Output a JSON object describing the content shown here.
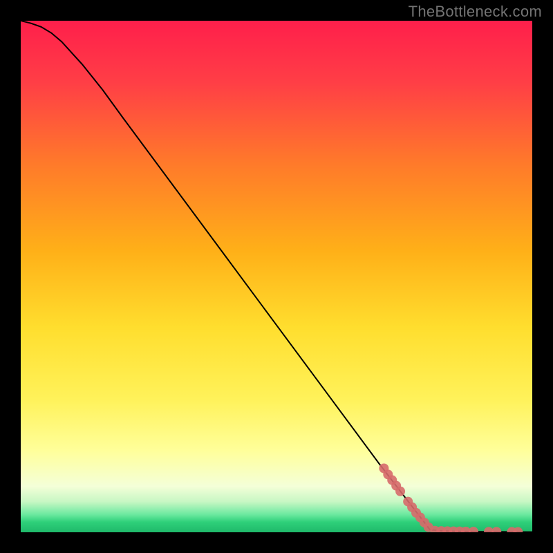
{
  "watermark": "TheBottleneck.com",
  "colors": {
    "background": "#000000",
    "curve": "#000000",
    "dot": "#d66a6a",
    "dot_stroke": "#d66a6a",
    "watermark": "#737373",
    "gradient_top": "#ff1f4b",
    "gradient_mid_upper": "#ff7a2a",
    "gradient_mid": "#ffde2e",
    "gradient_mid_lower": "#ffff7a",
    "gradient_lower": "#f2ffe0",
    "gradient_green": "#36e07f",
    "gradient_bottom": "#1fb96a"
  },
  "chart_data": {
    "type": "line",
    "title": "",
    "xlabel": "",
    "ylabel": "",
    "xlim": [
      0,
      100
    ],
    "ylim": [
      0,
      100
    ],
    "series": [
      {
        "name": "curve",
        "x": [
          0,
          2,
          4,
          6,
          8,
          12,
          16,
          20,
          30,
          40,
          50,
          60,
          70,
          80,
          82,
          84,
          86,
          90,
          94,
          100
        ],
        "y": [
          100,
          99.5,
          98.8,
          97.6,
          95.9,
          91.5,
          86.5,
          81.0,
          67.5,
          54.0,
          40.5,
          27.0,
          13.5,
          0.5,
          0.3,
          0.2,
          0.15,
          0.1,
          0.08,
          0.05
        ]
      }
    ],
    "scatter": {
      "name": "dots",
      "points": [
        {
          "x": 71.0,
          "y": 12.5
        },
        {
          "x": 71.8,
          "y": 11.3
        },
        {
          "x": 72.6,
          "y": 10.2
        },
        {
          "x": 73.4,
          "y": 9.1
        },
        {
          "x": 74.2,
          "y": 8.0
        },
        {
          "x": 75.7,
          "y": 6.0
        },
        {
          "x": 76.5,
          "y": 4.9
        },
        {
          "x": 77.3,
          "y": 3.8
        },
        {
          "x": 78.1,
          "y": 2.9
        },
        {
          "x": 78.9,
          "y": 1.9
        },
        {
          "x": 79.7,
          "y": 1.0
        },
        {
          "x": 81.0,
          "y": 0.3
        },
        {
          "x": 82.2,
          "y": 0.25
        },
        {
          "x": 83.4,
          "y": 0.22
        },
        {
          "x": 84.6,
          "y": 0.2
        },
        {
          "x": 85.8,
          "y": 0.18
        },
        {
          "x": 87.0,
          "y": 0.16
        },
        {
          "x": 88.5,
          "y": 0.14
        },
        {
          "x": 91.5,
          "y": 0.11
        },
        {
          "x": 93.0,
          "y": 0.1
        },
        {
          "x": 96.0,
          "y": 0.08
        },
        {
          "x": 97.2,
          "y": 0.07
        }
      ]
    }
  }
}
